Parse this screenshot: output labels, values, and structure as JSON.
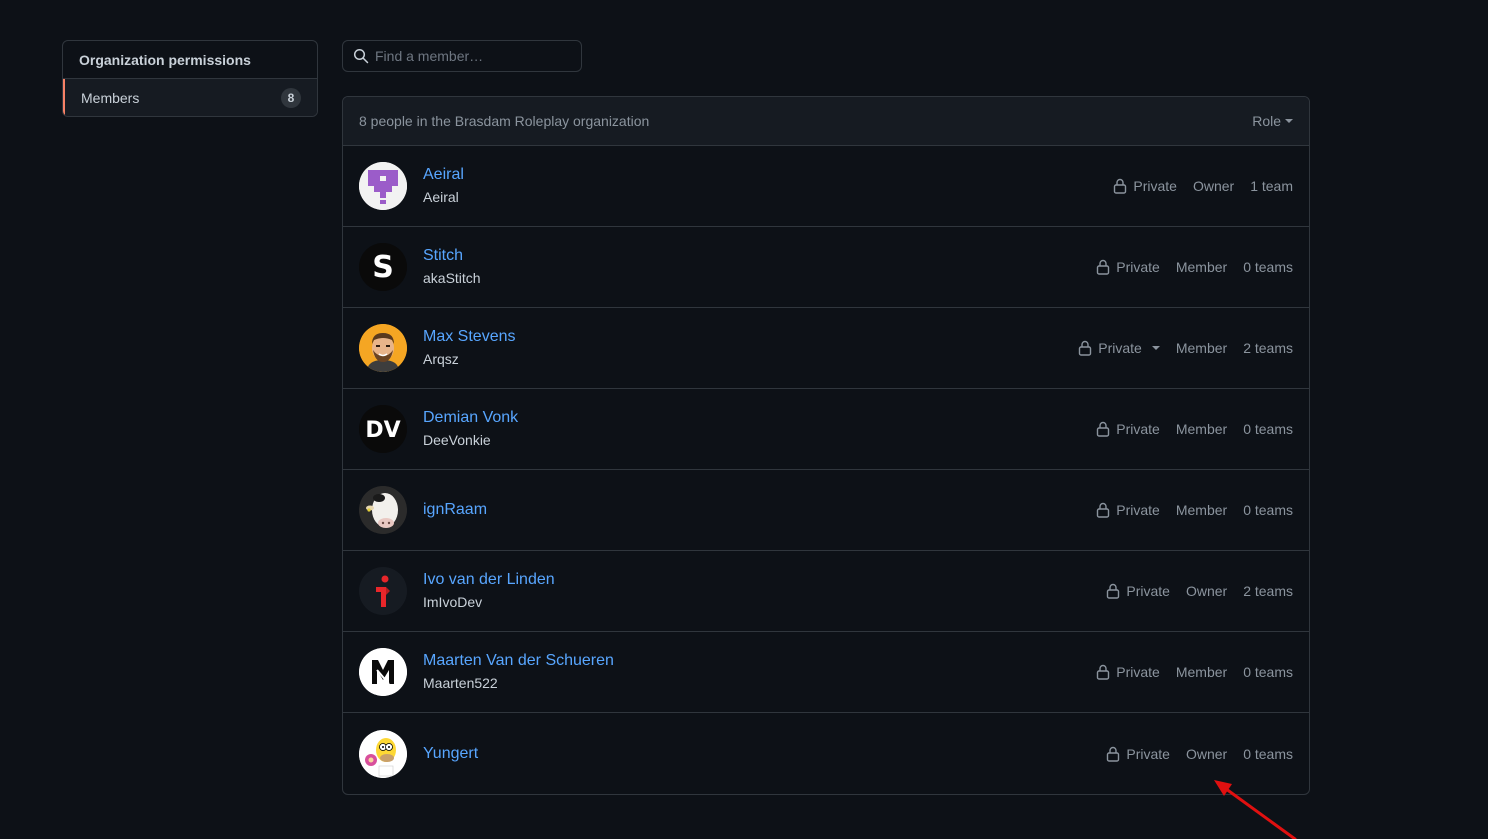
{
  "sidebar": {
    "heading": "Organization permissions",
    "items": [
      {
        "label": "Members",
        "count": "8"
      }
    ]
  },
  "search": {
    "placeholder": "Find a member…",
    "value": ""
  },
  "panel": {
    "summary": "8 people in the Brasdam Roleplay organization",
    "role_filter_label": "Role"
  },
  "members": [
    {
      "name": "Aeiral",
      "login": "Aeiral",
      "visibility": "Private",
      "role": "Owner",
      "teams": "1 team",
      "avatar": "purple-pixel-avatar"
    },
    {
      "name": "Stitch",
      "login": "akaStitch",
      "visibility": "Private",
      "role": "Member",
      "teams": "0 teams",
      "avatar": "s-logo-avatar"
    },
    {
      "name": "Max Stevens",
      "login": "Arqsz",
      "visibility": "Private",
      "role": "Member",
      "teams": "2 teams",
      "avatar": "bearded-man-avatar",
      "visibility_dropdown": true
    },
    {
      "name": "Demian Vonk",
      "login": "DeeVonkie",
      "visibility": "Private",
      "role": "Member",
      "teams": "0 teams",
      "avatar": "dv-logo-avatar"
    },
    {
      "name": "ignRaam",
      "login": "",
      "visibility": "Private",
      "role": "Member",
      "teams": "0 teams",
      "avatar": "cow-avatar"
    },
    {
      "name": "Ivo van der Linden",
      "login": "ImIvoDev",
      "visibility": "Private",
      "role": "Owner",
      "teams": "2 teams",
      "avatar": "red-i-logo-avatar"
    },
    {
      "name": "Maarten Van der Schueren",
      "login": "Maarten522",
      "visibility": "Private",
      "role": "Member",
      "teams": "0 teams",
      "avatar": "m-logo-avatar"
    },
    {
      "name": "Yungert",
      "login": "",
      "visibility": "Private",
      "role": "Owner",
      "teams": "0 teams",
      "avatar": "cartoon-character-avatar"
    }
  ],
  "colors": {
    "background": "#0d1117",
    "border": "#30363d",
    "link": "#58a6ff",
    "muted": "#8b949e",
    "accent": "#f78166",
    "annotation_arrow": "#e01010"
  }
}
